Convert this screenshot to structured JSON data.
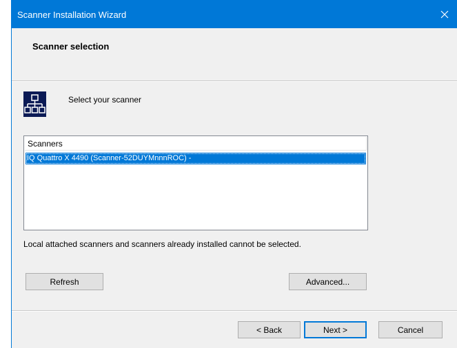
{
  "window": {
    "title": "Scanner Installation Wizard",
    "close_icon": "close-icon"
  },
  "header": {
    "title": "Scanner selection"
  },
  "content": {
    "icon": "network-scanner-icon",
    "prompt": "Select your scanner",
    "list": {
      "column_header": "Scanners",
      "items": [
        {
          "label": "IQ Quattro X 4490 (Scanner-52DUYMnnnROC) -",
          "selected": true
        }
      ]
    },
    "note": "Local attached scanners and scanners already installed cannot be selected.",
    "refresh_label": "Refresh",
    "advanced_label": "Advanced..."
  },
  "footer": {
    "back_label": "< Back",
    "next_label": "Next >",
    "cancel_label": "Cancel"
  },
  "colors": {
    "titlebar": "#0078d7",
    "selection": "#0078d7",
    "dialog_bg": "#f0f0f0",
    "icon_bg": "#0b1a55"
  }
}
